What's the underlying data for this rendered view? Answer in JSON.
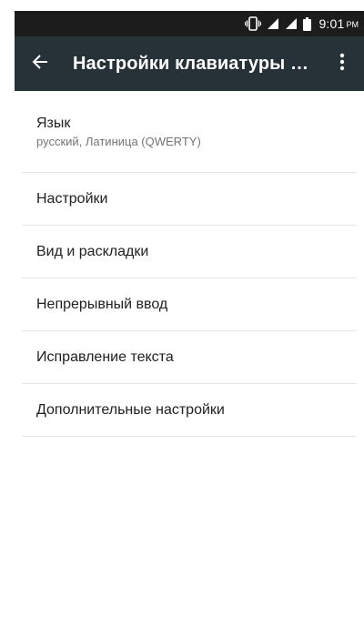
{
  "status_bar": {
    "time": "9:01",
    "ampm": "PM",
    "icons": [
      "vibrate-icon",
      "signal-icon",
      "signal-icon",
      "battery-icon"
    ]
  },
  "app_bar": {
    "title": "Настройки клавиатуры Gboard",
    "back_icon": "arrow-left-icon",
    "menu_icon": "more-vert-icon",
    "background": "#263238"
  },
  "settings": {
    "items": [
      {
        "title": "Язык",
        "summary": "русский, Латиница (QWERTY)"
      },
      {
        "title": "Настройки"
      },
      {
        "title": "Вид и раскладки"
      },
      {
        "title": "Непрерывный ввод"
      },
      {
        "title": "Исправление текста"
      },
      {
        "title": "Дополнительные настройки"
      }
    ]
  }
}
